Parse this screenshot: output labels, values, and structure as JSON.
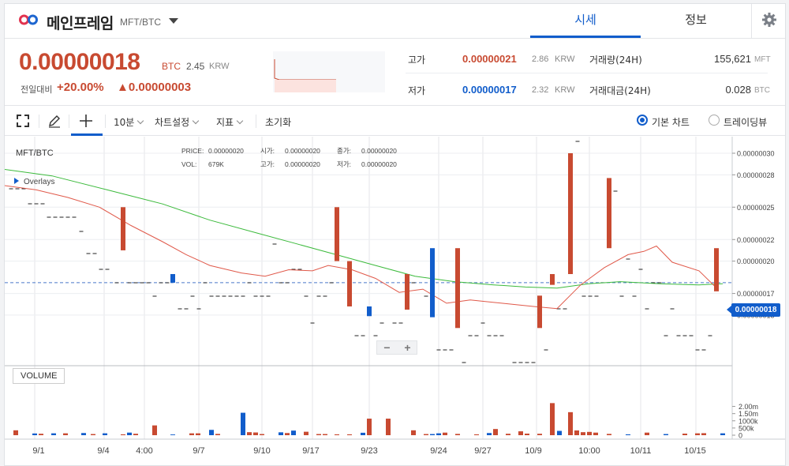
{
  "header": {
    "coin_name": "메인프레임",
    "pair": "MFT/BTC",
    "tabs": [
      {
        "label": "시세",
        "active": true
      },
      {
        "label": "정보",
        "active": false
      }
    ]
  },
  "price": {
    "current": "0.00000018",
    "unit": "BTC",
    "krw_value": "2.45",
    "krw_unit": "KRW",
    "change_label": "전일대비",
    "change_pct": "+20.00%",
    "change_abs": "▲0.00000003"
  },
  "stats": {
    "high_label": "고가",
    "high_value": "0.00000021",
    "high_krw": "2.86",
    "high_krw_unit": "KRW",
    "low_label": "저가",
    "low_value": "0.00000017",
    "low_krw": "2.32",
    "low_krw_unit": "KRW",
    "volume_label": "거래량(24H)",
    "volume_value": "155,621",
    "volume_unit": "MFT",
    "amount_label": "거래대금(24H)",
    "amount_value": "0.028",
    "amount_unit": "BTC"
  },
  "colors": {
    "up": "#c84a31",
    "down": "#115dcb",
    "ma_short": "#e0594a",
    "ma_long": "#3cba3c"
  },
  "toolbar": {
    "interval": "10분",
    "chart_settings": "차트설정",
    "indicators": "지표",
    "reset": "초기화",
    "radio_basic": "기본 차트",
    "radio_tv": "트레이딩뷰",
    "icons": [
      "fullscreen-icon",
      "pencil-icon",
      "crosshair-icon"
    ]
  },
  "chart": {
    "symbol": "MFT/BTC",
    "legend": {
      "price_label": "PRICE:",
      "price": "0.00000020",
      "open_label": "시가:",
      "open": "0.00000020",
      "close_label": "종가:",
      "close": "0.00000020",
      "vol_label": "VOL:",
      "vol": "679K",
      "high_label": "고가:",
      "high": "0.00000020",
      "low_label": "저가:",
      "low": "0.00000020"
    },
    "overlays_label": "Overlays",
    "volume_label": "VOLUME",
    "zoom_out": "−",
    "zoom_in": "+",
    "current_price_tag": "0.00000018"
  },
  "chart_data": {
    "type": "candlestick",
    "title": "MFT/BTC",
    "y_ticks": [
      "0.00000030",
      "0.00000028",
      "0.00000025",
      "0.00000022",
      "0.00000020",
      "0.00000017",
      "0.00000015"
    ],
    "x_ticks": [
      "9/1",
      "9/4",
      "4:00",
      "9/7",
      "9/10",
      "9/17",
      "9/23",
      "9/24",
      "9/27",
      "10/9",
      "10:00",
      "10/11",
      "10/15"
    ],
    "volume_ticks": [
      "2.00m",
      "1.50m",
      "1000k",
      "500k",
      "0"
    ],
    "current_price": 1.8e-07,
    "candles": [
      {
        "x": 150,
        "open": 2.5e-07,
        "close": 2.1e-07,
        "color": "up"
      },
      {
        "x": 213,
        "open": 1.8e-07,
        "close": 1.88e-07,
        "color": "down"
      },
      {
        "x": 421,
        "open": 2.5e-07,
        "close": 2e-07,
        "color": "up"
      },
      {
        "x": 437,
        "open": 2e-07,
        "close": 1.58e-07,
        "color": "up"
      },
      {
        "x": 462,
        "open": 1.58e-07,
        "close": 1.49e-07,
        "color": "down"
      },
      {
        "x": 510,
        "open": 1.88e-07,
        "close": 1.55e-07,
        "color": "up"
      },
      {
        "x": 542,
        "open": 2.12e-07,
        "close": 1.48e-07,
        "color": "down"
      },
      {
        "x": 574,
        "open": 2.12e-07,
        "close": 1.38e-07,
        "color": "up"
      },
      {
        "x": 678,
        "open": 1.68e-07,
        "close": 1.38e-07,
        "color": "up"
      },
      {
        "x": 694,
        "open": 1.88e-07,
        "close": 1.78e-07,
        "color": "up"
      },
      {
        "x": 717,
        "open": 3e-07,
        "close": 1.88e-07,
        "color": "up"
      },
      {
        "x": 766,
        "open": 2.77e-07,
        "close": 2.12e-07,
        "color": "up"
      },
      {
        "x": 902,
        "open": 2.12e-07,
        "close": 1.72e-07,
        "color": "up"
      }
    ],
    "volume": [
      {
        "x": 14,
        "v": 340000,
        "c": "up"
      },
      {
        "x": 38,
        "v": 120000,
        "c": "down"
      },
      {
        "x": 46,
        "v": 100000,
        "c": "up"
      },
      {
        "x": 62,
        "v": 130000,
        "c": "down"
      },
      {
        "x": 77,
        "v": 130000,
        "c": "up"
      },
      {
        "x": 100,
        "v": 150000,
        "c": "down"
      },
      {
        "x": 112,
        "v": 80000,
        "c": "up"
      },
      {
        "x": 127,
        "v": 130000,
        "c": "down"
      },
      {
        "x": 150,
        "v": 60000,
        "c": "up"
      },
      {
        "x": 158,
        "v": 180000,
        "c": "down"
      },
      {
        "x": 166,
        "v": 100000,
        "c": "up"
      },
      {
        "x": 190,
        "v": 680000,
        "c": "up"
      },
      {
        "x": 213,
        "v": 50000,
        "c": "down"
      },
      {
        "x": 237,
        "v": 130000,
        "c": "up"
      },
      {
        "x": 245,
        "v": 130000,
        "c": "up"
      },
      {
        "x": 262,
        "v": 370000,
        "c": "down"
      },
      {
        "x": 270,
        "v": 90000,
        "c": "up"
      },
      {
        "x": 302,
        "v": 1560000,
        "c": "down"
      },
      {
        "x": 310,
        "v": 210000,
        "c": "up"
      },
      {
        "x": 318,
        "v": 190000,
        "c": "up"
      },
      {
        "x": 326,
        "v": 80000,
        "c": "up"
      },
      {
        "x": 350,
        "v": 200000,
        "c": "down"
      },
      {
        "x": 358,
        "v": 150000,
        "c": "up"
      },
      {
        "x": 366,
        "v": 320000,
        "c": "down"
      },
      {
        "x": 382,
        "v": 240000,
        "c": "up"
      },
      {
        "x": 398,
        "v": 80000,
        "c": "up"
      },
      {
        "x": 406,
        "v": 80000,
        "c": "up"
      },
      {
        "x": 421,
        "v": 60000,
        "c": "up"
      },
      {
        "x": 437,
        "v": 60000,
        "c": "up"
      },
      {
        "x": 454,
        "v": 170000,
        "c": "down"
      },
      {
        "x": 462,
        "v": 1150000,
        "c": "up"
      },
      {
        "x": 486,
        "v": 1150000,
        "c": "up"
      },
      {
        "x": 518,
        "v": 340000,
        "c": "up"
      },
      {
        "x": 534,
        "v": 80000,
        "c": "up"
      },
      {
        "x": 542,
        "v": 80000,
        "c": "down"
      },
      {
        "x": 550,
        "v": 130000,
        "c": "down"
      },
      {
        "x": 558,
        "v": 180000,
        "c": "up"
      },
      {
        "x": 574,
        "v": 90000,
        "c": "up"
      },
      {
        "x": 598,
        "v": 60000,
        "c": "up"
      },
      {
        "x": 614,
        "v": 150000,
        "c": "down"
      },
      {
        "x": 622,
        "v": 430000,
        "c": "up"
      },
      {
        "x": 638,
        "v": 100000,
        "c": "up"
      },
      {
        "x": 654,
        "v": 270000,
        "c": "up"
      },
      {
        "x": 662,
        "v": 110000,
        "c": "up"
      },
      {
        "x": 678,
        "v": 100000,
        "c": "up"
      },
      {
        "x": 694,
        "v": 2230000,
        "c": "up"
      },
      {
        "x": 703,
        "v": 300000,
        "c": "down"
      },
      {
        "x": 717,
        "v": 1600000,
        "c": "up"
      },
      {
        "x": 725,
        "v": 330000,
        "c": "up"
      },
      {
        "x": 733,
        "v": 210000,
        "c": "up"
      },
      {
        "x": 741,
        "v": 230000,
        "c": "up"
      },
      {
        "x": 749,
        "v": 180000,
        "c": "up"
      },
      {
        "x": 766,
        "v": 90000,
        "c": "up"
      },
      {
        "x": 790,
        "v": 60000,
        "c": "down"
      },
      {
        "x": 814,
        "v": 180000,
        "c": "up"
      },
      {
        "x": 838,
        "v": 80000,
        "c": "down"
      },
      {
        "x": 862,
        "v": 110000,
        "c": "up"
      },
      {
        "x": 878,
        "v": 130000,
        "c": "up"
      },
      {
        "x": 886,
        "v": 140000,
        "c": "up"
      },
      {
        "x": 910,
        "v": 130000,
        "c": "down"
      }
    ]
  }
}
